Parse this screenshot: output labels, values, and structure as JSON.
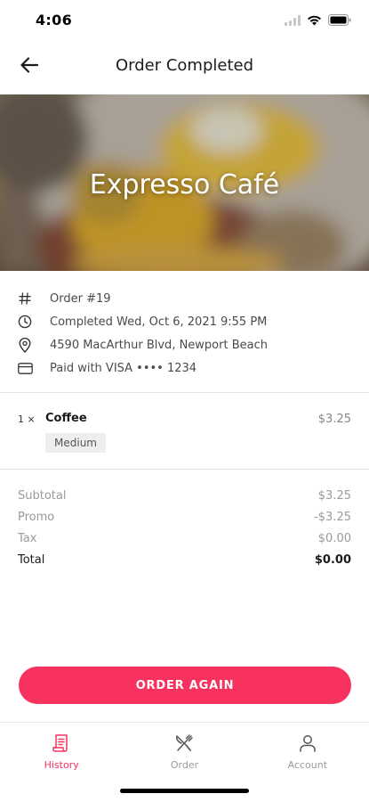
{
  "status_bar": {
    "time": "4:06"
  },
  "header": {
    "title": "Order Completed",
    "back_icon": "arrow-left-icon"
  },
  "hero": {
    "restaurant_name": "Expresso Café"
  },
  "order_info": {
    "order_number": "Order #19",
    "completed": "Completed Wed, Oct 6, 2021 9:55 PM",
    "address": "4590 MacArthur Blvd, Newport Beach",
    "payment": "Paid with VISA •••• 1234"
  },
  "items": [
    {
      "qty": "1 ×",
      "name": "Coffee",
      "price": "$3.25",
      "modifier": "Medium"
    }
  ],
  "totals": {
    "subtotal_label": "Subtotal",
    "subtotal": "$3.25",
    "promo_label": "Promo",
    "promo": "-$3.25",
    "tax_label": "Tax",
    "tax": "$0.00",
    "total_label": "Total",
    "total": "$0.00"
  },
  "cta": {
    "label": "ORDER AGAIN"
  },
  "tabs": [
    {
      "label": "History",
      "icon": "receipt-icon",
      "active": true
    },
    {
      "label": "Order",
      "icon": "utensils-icon",
      "active": false
    },
    {
      "label": "Account",
      "icon": "user-icon",
      "active": false
    }
  ],
  "colors": {
    "accent": "#f7325f",
    "text": "#1c1c1c",
    "muted": "#9a9a9a"
  }
}
